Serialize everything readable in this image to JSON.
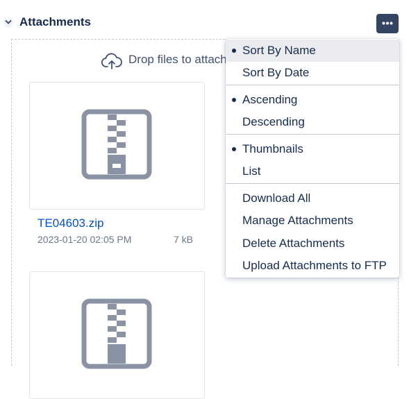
{
  "header": {
    "title": "Attachments"
  },
  "dropzone": {
    "message": "Drop files to attach"
  },
  "attachments": [
    {
      "name": "TE04603.zip",
      "date": "2023-01-20 02:05 PM",
      "size": "7 kB"
    },
    {
      "name": "",
      "date": "",
      "size": ""
    }
  ],
  "menu": {
    "sort": [
      {
        "label": "Sort By Name",
        "selected": true
      },
      {
        "label": "Sort By Date",
        "selected": false
      }
    ],
    "order": [
      {
        "label": "Ascending",
        "selected": true
      },
      {
        "label": "Descending",
        "selected": false
      }
    ],
    "view": [
      {
        "label": "Thumbnails",
        "selected": true
      },
      {
        "label": "List",
        "selected": false
      }
    ],
    "actions": [
      {
        "label": "Download All"
      },
      {
        "label": "Manage Attachments"
      },
      {
        "label": "Delete Attachments"
      },
      {
        "label": "Upload Attachments to FTP"
      }
    ]
  },
  "icons": {
    "collapse": "chevron-down-icon",
    "more": "more-icon",
    "upload": "cloud-upload-icon",
    "file": "zip-file-icon"
  },
  "colors": {
    "accent_dark": "#344563",
    "link": "#0052cc",
    "icon_gray": "#8993a4",
    "menu_highlight": "#ebecf0"
  }
}
